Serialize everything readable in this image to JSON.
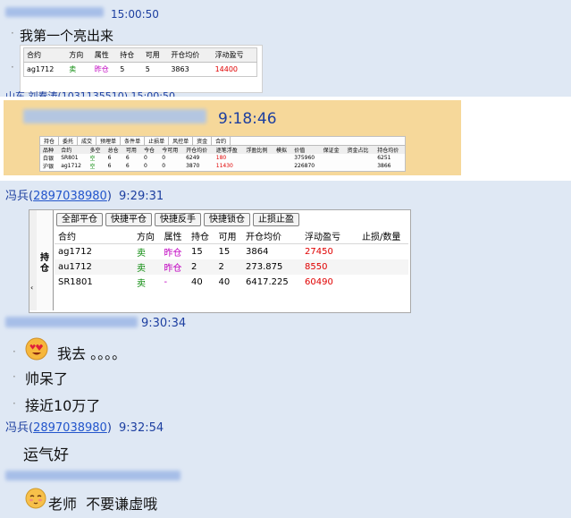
{
  "msg1": {
    "time": "15:00:50",
    "text": "我第一个亮出来",
    "table": {
      "headers": [
        "合约",
        "方向",
        "属性",
        "持仓",
        "可用",
        "开仓均价",
        "浮动盈亏"
      ],
      "row": [
        "ag1712",
        "卖",
        "昨仓",
        "5",
        "5",
        "3863",
        "14400"
      ]
    },
    "next_sender_partial": "山东 刘春涛(1031135510) 15:00:50"
  },
  "msg2": {
    "time": "9:18:46",
    "tabs": [
      "持仓",
      "委托",
      "成交",
      "预埋单",
      "条件单",
      "止损单",
      "风控单",
      "资金",
      "合约"
    ],
    "headers": [
      "品种",
      "合约",
      "多空",
      "总仓",
      "可用",
      "今仓",
      "今可用",
      "开仓均价",
      "逐笔浮盈",
      "浮盈比例",
      "模拟",
      "价值",
      "保证金",
      "资金占比",
      "持仓均价"
    ],
    "rows": [
      [
        "白银",
        "SR801",
        "空",
        "6",
        "6",
        "0",
        "0",
        "6249",
        "180",
        "",
        "",
        "375960",
        "",
        "",
        "6251"
      ],
      [
        "沪银",
        "ag1712",
        "空",
        "6",
        "6",
        "0",
        "0",
        "3870",
        "11430",
        "",
        "",
        "226870",
        "",
        "",
        "3866"
      ]
    ]
  },
  "msg3": {
    "sender_name": "冯兵",
    "sender_qq": "2897038980",
    "time": "9:29:31",
    "side_tab": "持仓",
    "buttons": [
      "全部平仓",
      "快捷平仓",
      "快捷反手",
      "快捷锁仓",
      "止损止盈"
    ],
    "headers": [
      "合约",
      "方向",
      "属性",
      "持仓",
      "可用",
      "开仓均价",
      "浮动盈亏",
      "止损/数量"
    ],
    "rows": [
      [
        "ag1712",
        "卖",
        "昨仓",
        "15",
        "15",
        "3864",
        "27450",
        ""
      ],
      [
        "au1712",
        "卖",
        "昨仓",
        "2",
        "2",
        "273.875",
        "8550",
        ""
      ],
      [
        "SR1801",
        "卖",
        "-",
        "40",
        "40",
        "6417.225",
        "60490",
        ""
      ]
    ]
  },
  "msg4": {
    "time": "9:30:34",
    "lines": [
      "我去 。。。。",
      "帅呆了",
      "接近10万了"
    ]
  },
  "msg5": {
    "sender_name": "冯兵",
    "sender_qq": "2897038980",
    "time": "9:32:54",
    "text": "运气好"
  },
  "msg6": {
    "text": "老师  不要谦虚哦"
  },
  "colors": {
    "chat_bg": "#dfe8f4",
    "sender": "#1d3fa0",
    "sell": "#0a8a0a",
    "open": "#c000c0",
    "profit": "#e00000",
    "panel2_bg": "#f6d89a"
  },
  "icons": [
    "heart-eyes-emoji-icon",
    "shy-emoji-icon"
  ]
}
